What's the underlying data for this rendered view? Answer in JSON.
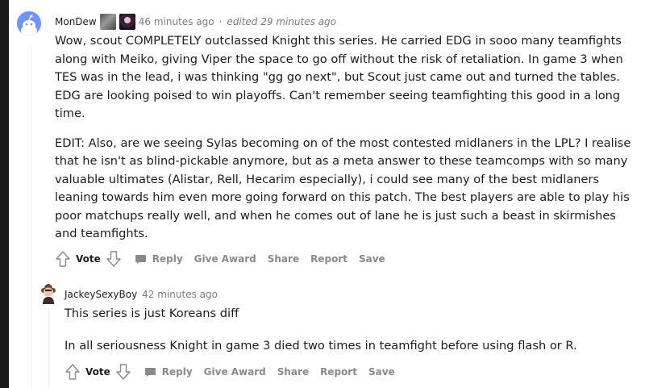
{
  "comment": {
    "username": "MonDew",
    "timestamp": "46 minutes ago",
    "separator": "·",
    "edited": "edited 29 minutes ago",
    "paragraphs": [
      "Wow, scout COMPLETELY outclassed Knight this series. He carried EDG in sooo many teamfights along with Meiko, giving Viper the space to go off without the risk of retaliation. In game 3 when TES was in the lead, i was thinking \"gg go next\", but Scout just came out and turned the tables. EDG are looking poised to win playoffs. Can't remember seeing teamfighting this good in a long time.",
      "EDIT: Also, are we seeing Sylas becoming on of the most contested midlaners in the LPL? I realise that he isn't as blind-pickable anymore, but as a meta answer to these teamcomps with so many valuable ultimates (Alistar, Rell, Hecarim especially), i could see many of the best midlaners leaning towards him even more going forward on this patch. The best players are able to play his poor matchups really well, and when he comes out of lane he is just such a beast in skirmishes and teamfights."
    ],
    "actions": {
      "vote": "Vote",
      "reply": "Reply",
      "give_award": "Give Award",
      "share": "Share",
      "report": "Report",
      "save": "Save"
    }
  },
  "reply": {
    "username": "JackeySexyBoy",
    "timestamp": "42 minutes ago",
    "paragraphs": [
      "This series is just Koreans diff",
      "In all seriousness Knight in game 3 died two times in teamfight before using flash or R."
    ],
    "actions": {
      "vote": "Vote",
      "reply": "Reply",
      "give_award": "Give Award",
      "share": "Share",
      "report": "Report",
      "save": "Save"
    }
  },
  "colors": {
    "text": "#1c1c1c",
    "meta": "#7c7c7c",
    "action": "#878a8c",
    "thread_line": "#edeff1",
    "avatar": "#7193ff",
    "page_edge": "#1a1a1b"
  },
  "icons": {
    "avatar": "reddit-snoo-avatar",
    "upvote": "arrow-up-icon",
    "downvote": "arrow-down-icon",
    "reply": "speech-bubble-icon"
  }
}
